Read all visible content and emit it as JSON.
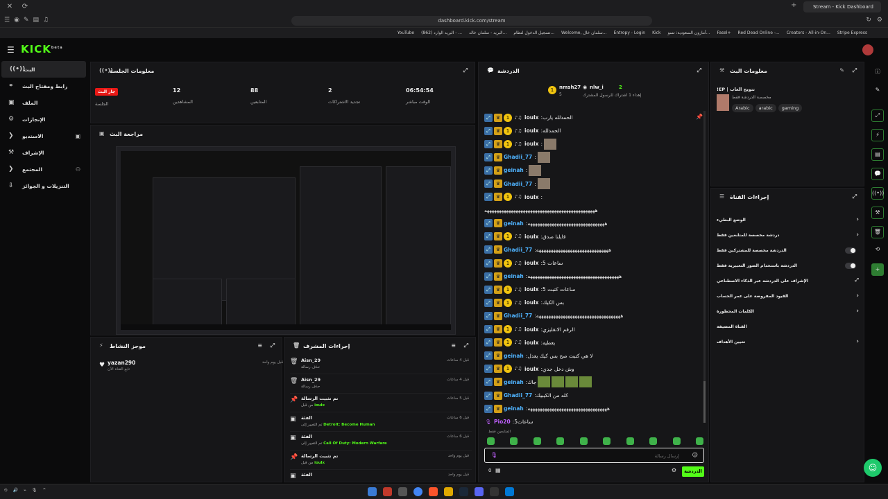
{
  "browser": {
    "tab_title": "Stream - Kick Dashboard",
    "url": "dashboard.kick.com/stream",
    "bookmarks": [
      "YouTube",
      "(862) البريد الوارد - ...",
      "البريد - سلمان خالد...",
      "تسجيل الدخول لنظام...",
      "Welcome, سلمان خال...",
      "Entropy - Login",
      "Kick",
      "أمازون السعودية: تسو...",
      "Fasel+",
      "Red Dead Online -...",
      "Creators - All-in-On...",
      "Stripe Express"
    ]
  },
  "header": {
    "logo": "KICK",
    "logo_sup": "beta"
  },
  "sidebar": {
    "items": [
      {
        "label": "البث",
        "icon": "((•))"
      },
      {
        "label": "رابط ومفتاح البث",
        "icon": "⚭"
      },
      {
        "label": "الملف",
        "icon": "▣"
      },
      {
        "label": "الإنجازات",
        "icon": "⚙"
      },
      {
        "label": "الاستديو",
        "icon": "❯"
      },
      {
        "label": "الإشراف",
        "icon": "⚒"
      },
      {
        "label": "المجتمع",
        "icon": "❯"
      },
      {
        "label": "التنزيلات و الجوائز",
        "icon": "⇩"
      }
    ]
  },
  "session": {
    "title": "معلومات الجلسة",
    "live_badge": "جار البث",
    "stats": [
      {
        "value": "",
        "label": "الجلسة"
      },
      {
        "value": "12",
        "label": "المشاهدين"
      },
      {
        "value": "88",
        "label": "المتابعين"
      },
      {
        "value": "2",
        "label": "تجديد الاشتراكات"
      },
      {
        "value": "06:54:54",
        "label": "الوقت مباشر"
      }
    ]
  },
  "preview": {
    "title": "مراجعة البث"
  },
  "activity": {
    "title": "موجز النشاط",
    "items": [
      {
        "name": "yazan290",
        "desc": "تابع القناة الآن",
        "time": "قبل يوم واحد"
      }
    ]
  },
  "mod": {
    "title": "إجراءات المشرف",
    "items": [
      {
        "icon": "🗑",
        "title": "Aisn_29",
        "desc": "حذف رسالة",
        "hl": "",
        "time": "قبل 4 ساعات"
      },
      {
        "icon": "🗑",
        "title": "Aisn_29",
        "desc": "حذف رسالة",
        "hl": "",
        "time": "قبل 4 ساعات"
      },
      {
        "icon": "📌",
        "title": "تم تثبيت الرسالة",
        "desc": "من قبل",
        "hl": "ioulx",
        "time": "قبل 5 ساعات"
      },
      {
        "icon": "▣",
        "title": "الفئة",
        "desc": "تم التغيير إلى",
        "hl": "Detroit: Become Human",
        "time": "قبل 6 ساعات"
      },
      {
        "icon": "▣",
        "title": "الفئة",
        "desc": "تم التغيير إلى",
        "hl": "Call Of Duty: Modern Warfare",
        "time": "قبل 6 ساعات"
      },
      {
        "icon": "📌",
        "title": "تم تثبيت الرسالة",
        "desc": "من قبل",
        "hl": "ioulx",
        "time": "قبل يوم واحد"
      },
      {
        "icon": "▣",
        "title": "الفئة",
        "desc": "",
        "hl": "",
        "time": "قبل يوم واحد"
      }
    ]
  },
  "chat": {
    "title": "الدردشة",
    "pinned": [
      {
        "name": "nmsh27",
        "sub": "5"
      },
      {
        "name": "nlw_i",
        "sub": "2"
      }
    ],
    "pinned_sub": "إهداء 1 اشتراك للرسول المشترك",
    "messages": [
      {
        "name": "ioulx",
        "color": "#e6e6e6",
        "badges": [
          "pin",
          "crown",
          "one",
          "music"
        ],
        "text": "الحمدلله يارب",
        "emotes": 0
      },
      {
        "name": "ioulx",
        "color": "#e6e6e6",
        "badges": [
          "pin",
          "crown",
          "one",
          "music"
        ],
        "text": "الحمدلله",
        "emotes": 0
      },
      {
        "name": "ioulx",
        "color": "#e6e6e6",
        "badges": [
          "pin",
          "crown",
          "one",
          "music"
        ],
        "text": "",
        "emotes": 1
      },
      {
        "name": "Ghadii_77",
        "color": "#4fb3ff",
        "badges": [
          "pin",
          "crown"
        ],
        "text": "",
        "emotes": 1
      },
      {
        "name": "geinah",
        "color": "#4fb3ff",
        "badges": [
          "pin",
          "crown"
        ],
        "text": "",
        "emotes": 1
      },
      {
        "name": "Ghadii_77",
        "color": "#4fb3ff",
        "badges": [
          "pin",
          "crown"
        ],
        "text": "",
        "emotes": 1
      },
      {
        "name": "ioulx",
        "color": "#e6e6e6",
        "badges": [
          "pin",
          "crown",
          "one",
          "music"
        ],
        "text": "",
        "emotes": 0
      },
      {
        "name": "",
        "color": "#e6e6e6",
        "badges": [],
        "text": "ههههههههههههههههههههههههههههههههههههههههههههههه",
        "emotes": 0
      },
      {
        "name": "geinah",
        "color": "#4fb3ff",
        "badges": [
          "pin",
          "crown"
        ],
        "text": "ههههههههههههههههههههههههههههههههه",
        "emotes": 0
      },
      {
        "name": "ioulx",
        "color": "#e6e6e6",
        "badges": [
          "pin",
          "crown",
          "one",
          "music"
        ],
        "text": "قايلنا صدق",
        "emotes": 0
      },
      {
        "name": "Ghadii_77",
        "color": "#4fb3ff",
        "badges": [
          "pin",
          "crown"
        ],
        "text": "ههههههههههههههههههههههههههههههه",
        "emotes": 0
      },
      {
        "name": "ioulx",
        "color": "#e6e6e6",
        "badges": [
          "pin",
          "crown",
          "one",
          "music"
        ],
        "text": "ساعات 5",
        "emotes": 0
      },
      {
        "name": "geinah",
        "color": "#4fb3ff",
        "badges": [
          "pin",
          "crown"
        ],
        "text": "ههههههههههههههههههههههههههههههههههههههه",
        "emotes": 0
      },
      {
        "name": "ioulx",
        "color": "#e6e6e6",
        "badges": [
          "pin",
          "crown",
          "one",
          "music"
        ],
        "text": "ساعات كتبت 5",
        "emotes": 0
      },
      {
        "name": "ioulx",
        "color": "#e6e6e6",
        "badges": [
          "pin",
          "crown",
          "one",
          "music"
        ],
        "text": "بس الكيك",
        "emotes": 0
      },
      {
        "name": "Ghadii_77",
        "color": "#4fb3ff",
        "badges": [
          "pin",
          "crown"
        ],
        "text": "هههههههههههههههههههههههههههههههههههه",
        "emotes": 0
      },
      {
        "name": "ioulx",
        "color": "#e6e6e6",
        "badges": [
          "pin",
          "crown",
          "one",
          "music"
        ],
        "text": "الرقم الانقليزي",
        "emotes": 0
      },
      {
        "name": "ioulx",
        "color": "#e6e6e6",
        "badges": [
          "pin",
          "crown",
          "one",
          "music"
        ],
        "text": "يعطيه",
        "emotes": 0
      },
      {
        "name": "geinah",
        "color": "#4fb3ff",
        "badges": [
          "pin",
          "crown"
        ],
        "text": "لا هي كتبت صح بس كيك يعدل",
        "emotes": 0
      },
      {
        "name": "ioulx",
        "color": "#e6e6e6",
        "badges": [
          "pin",
          "crown",
          "one",
          "music"
        ],
        "text": "وش دخل جدي",
        "emotes": 0
      },
      {
        "name": "geinah",
        "color": "#4fb3ff",
        "badges": [
          "pin",
          "crown"
        ],
        "text": "جاك",
        "emotes": 4
      },
      {
        "name": "Ghadii_77",
        "color": "#4fb3ff",
        "badges": [
          "pin",
          "crown"
        ],
        "text": "كله من الكيبيك",
        "emotes": 0
      },
      {
        "name": "geinah",
        "color": "#4fb3ff",
        "badges": [
          "pin",
          "crown"
        ],
        "text": "هههههههههههههههههههههههههههههههههه",
        "emotes": 0
      },
      {
        "name": "Pio20",
        "color": "#c060ff",
        "badges": [
          "mic"
        ],
        "text": "ساعات5",
        "emotes": 0
      }
    ],
    "followers_only": "المتابعين فقط",
    "input_placeholder": "إرسال رسالة",
    "count": "0",
    "send_label": "الدردشة"
  },
  "stream_info": {
    "title": "معلومات البث",
    "stream_title": "!EP | تتويج العاب",
    "category": "مخصصة الدردشة فقط",
    "tags": [
      "Arabic",
      "arabic",
      "gaming"
    ]
  },
  "channel_actions": {
    "title": "إجراءات القناة",
    "rows": [
      {
        "label": "الوضع البطيء",
        "control": "chev"
      },
      {
        "label": "دردشة مخصصة للمتابعين فقط",
        "control": "chev"
      },
      {
        "label": "الدردشة مخصصة للمشتركين فقط",
        "control": "toggle"
      },
      {
        "label": "الدردشة باستخدام الصور التعبيرية فقط",
        "control": "toggle"
      },
      {
        "label": "الإشراف على الدردشة عبر الذكاء الاصطناعي",
        "control": "ext"
      },
      {
        "label": "القيود المفروضة على عمر الحساب",
        "control": "chev"
      },
      {
        "label": "الكلمات المحظورة",
        "control": "chev"
      },
      {
        "label": "القناة المضيفة",
        "control": "none"
      },
      {
        "label": "تعيين الأهداف",
        "control": "chev"
      }
    ]
  },
  "colors": {
    "accent": "#53fc18",
    "live": "#e91916"
  }
}
